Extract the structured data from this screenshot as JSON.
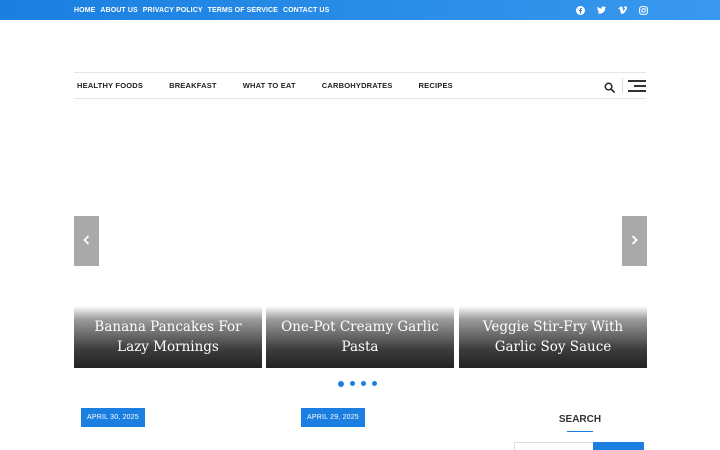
{
  "topbar": {
    "links": [
      "HOME",
      "ABOUT US",
      "PRIVACY POLICY",
      "TERMS OF SERVICE",
      "CONTACT US"
    ],
    "social_icons": [
      "facebook-icon",
      "twitter-icon",
      "vimeo-icon",
      "instagram-icon"
    ]
  },
  "nav": {
    "items": [
      "HEALTHY FOODS",
      "BREAKFAST",
      "WHAT TO EAT",
      "CARBOHYDRATES",
      "RECIPES"
    ],
    "icons": [
      "search-icon",
      "menu-icon"
    ]
  },
  "slider": {
    "slides": [
      "Banana Pancakes For Lazy Mornings",
      "One-Pot Creamy Garlic Pasta",
      "Veggie Stir-Fry With Garlic Soy Sauce"
    ],
    "dot_count": 4,
    "active_dot": 1
  },
  "posts": [
    {
      "date": "APRIL 30, 2025"
    },
    {
      "date": "APRIL 29, 2025"
    }
  ],
  "sidebar": {
    "search_title": "SEARCH"
  },
  "colors": {
    "accent": "#1a7fe0",
    "arrow_bg": "#a9a9a9"
  }
}
